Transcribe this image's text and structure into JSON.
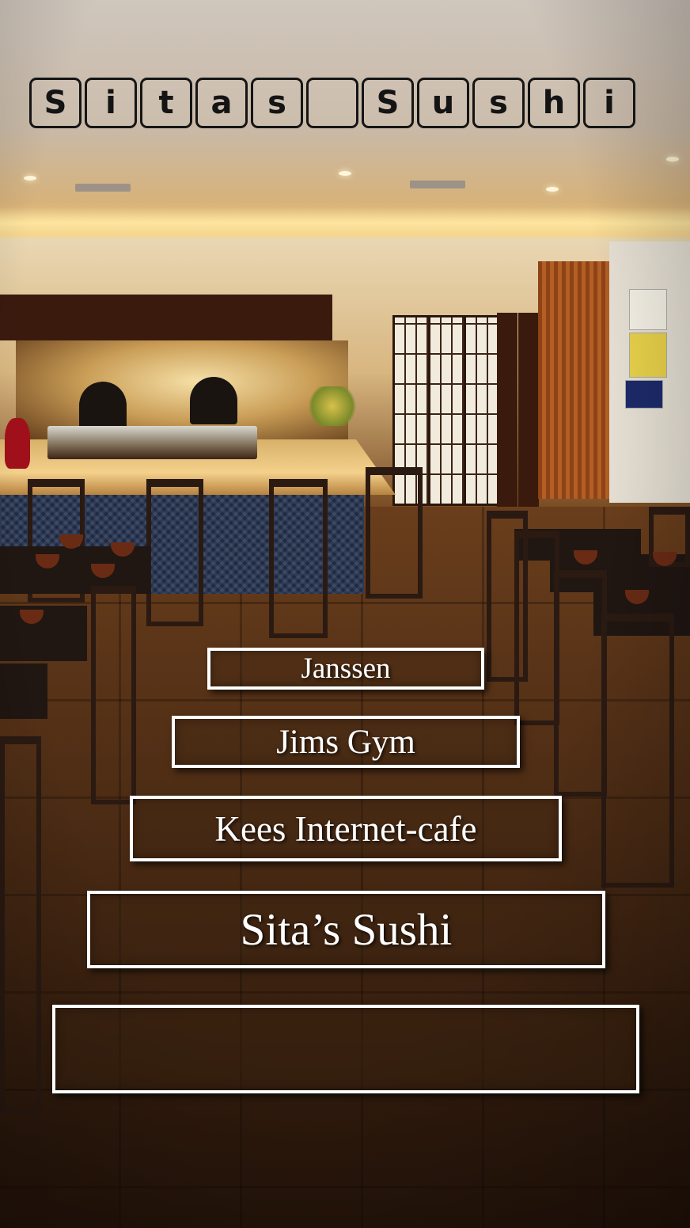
{
  "title": {
    "letters": [
      "S",
      "i",
      "t",
      "a",
      "s",
      "",
      "S",
      "u",
      "s",
      "h",
      "i"
    ]
  },
  "menu": {
    "items": [
      {
        "label": "Janssen"
      },
      {
        "label": "Jims Gym"
      },
      {
        "label": "Kees Internet-cafe"
      },
      {
        "label": "Sita’s Sushi"
      },
      {
        "label": ""
      }
    ]
  },
  "background": {
    "scene": "restaurant-interior-image"
  }
}
